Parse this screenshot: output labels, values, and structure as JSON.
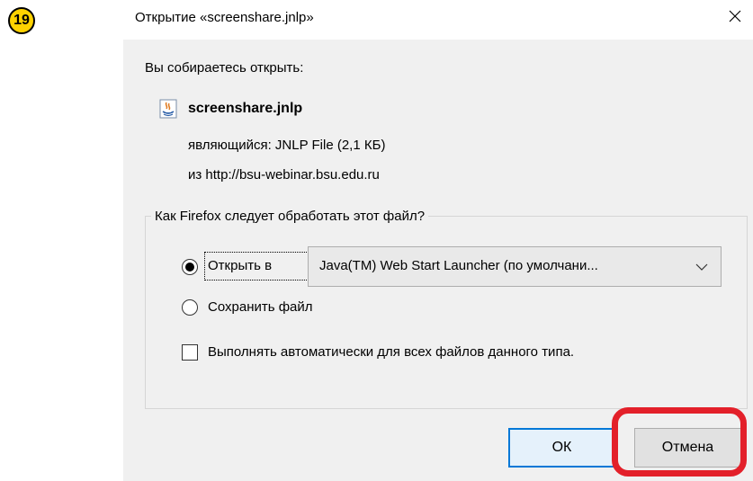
{
  "step_number": "19",
  "dialog": {
    "title": "Открытие «screenshare.jnlp»",
    "intro": "Вы собираетесь открыть:",
    "file_name": "screenshare.jnlp",
    "file_type": "являющийся:  JNLP File (2,1 КБ)",
    "file_source": "из  http://bsu-webinar.bsu.edu.ru",
    "action_group_label": "Как Firefox следует обработать этот файл?",
    "open_with_label": "Открыть в",
    "open_with_app": "Java(TM) Web Start Launcher (по умолчани...",
    "save_file_label": "Сохранить файл",
    "auto_label": "Выполнять автоматически для всех файлов данного типа.",
    "ok_label": "ОК",
    "cancel_label": "Отмена"
  },
  "state": {
    "selected_action": "open_with",
    "auto_checked": false
  },
  "colors": {
    "highlight": "#e3202a",
    "badge": "#ffd200",
    "focus_border": "#0078d7"
  }
}
